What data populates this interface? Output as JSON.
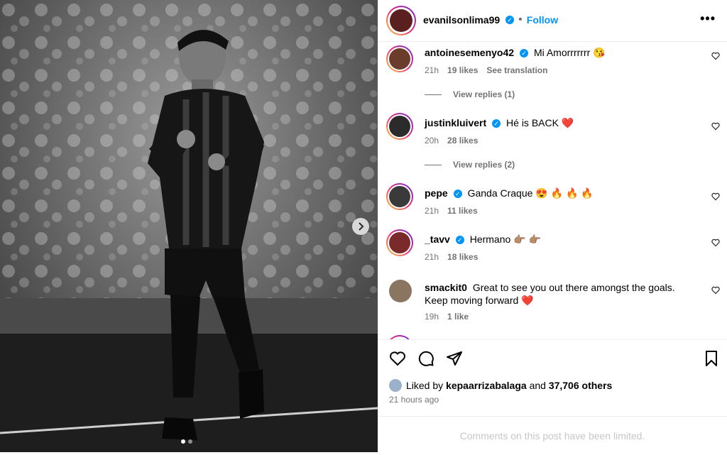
{
  "post": {
    "author": "evanilsonlima99",
    "follow_label": "Follow",
    "more_label": "•••",
    "carousel": {
      "current": 1,
      "total": 2
    }
  },
  "comments": [
    {
      "username": "antoinesemenyo42",
      "verified": true,
      "text": "Mi Amorrrrrrr 😘",
      "time": "21h",
      "likes": "19 likes",
      "extra": "See translation",
      "replies": "View replies (1)"
    },
    {
      "username": "justinkluivert",
      "verified": true,
      "text": "Hé is BACK ❤️",
      "time": "20h",
      "likes": "28 likes",
      "extra": "",
      "replies": "View replies (2)"
    },
    {
      "username": "pepe",
      "verified": true,
      "text": "Ganda Craque 😍 🔥 🔥 🔥",
      "time": "21h",
      "likes": "11 likes",
      "extra": "",
      "replies": ""
    },
    {
      "username": "_tavv",
      "verified": true,
      "text": "Hermano 👉🏽 👉🏽",
      "time": "21h",
      "likes": "18 likes",
      "extra": "",
      "replies": ""
    },
    {
      "username": "smackit0",
      "verified": false,
      "text": "Great to see you out there amongst the goals. Keep moving forward ❤️",
      "time": "19h",
      "likes": "1 like",
      "extra": "",
      "replies": ""
    }
  ],
  "likes": {
    "prefix": "Liked by",
    "user": "kepaarrizabalaga",
    "and": "and",
    "others": "37,706 others"
  },
  "timestamp": "21 hours ago",
  "comments_limited": "Comments on this post have been limited.",
  "icons": [
    "heart-icon",
    "comment-icon",
    "share-icon",
    "save-icon",
    "chevron-right-icon",
    "more-icon",
    "verified-icon"
  ],
  "colors": {
    "accent": "#0095f6",
    "heart_red": "#ed4956",
    "muted": "#737373"
  }
}
